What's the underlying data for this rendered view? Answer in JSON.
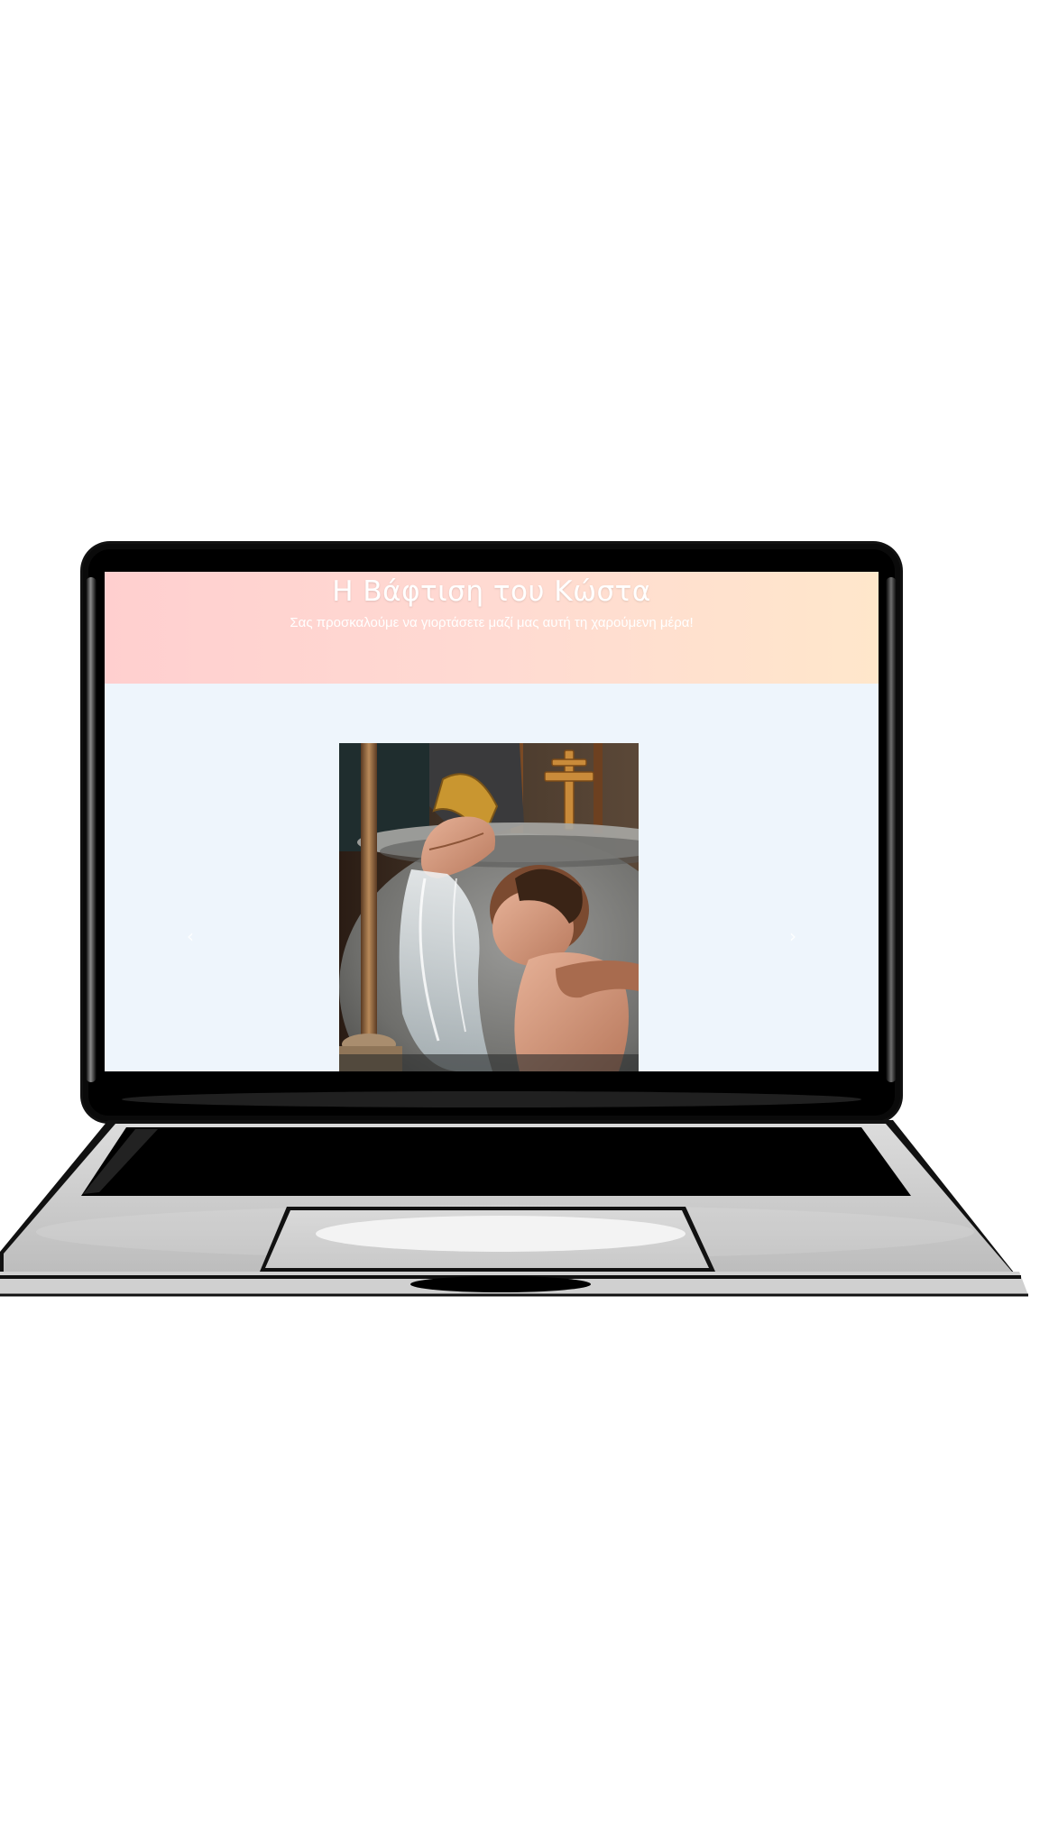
{
  "invitation": {
    "title": "Η Βάφτιση του Κώστα",
    "subtitle": "Σας προσκαλούμε να γιορτάσετε μαζί μας αυτή τη χαρούμενη μέρα!"
  },
  "gallery": {
    "prev_icon": "chevron-left-icon",
    "next_icon": "chevron-right-icon",
    "prev_glyph": "‹",
    "next_glyph": "›",
    "photo_subject": "baptism-photo"
  },
  "colors": {
    "hero_start": "#ffcfcf",
    "hero_end": "#ffe7cb",
    "gallery_bg": "#eef5fc",
    "bezel": "#000000",
    "deck": "#d3d3d3"
  }
}
